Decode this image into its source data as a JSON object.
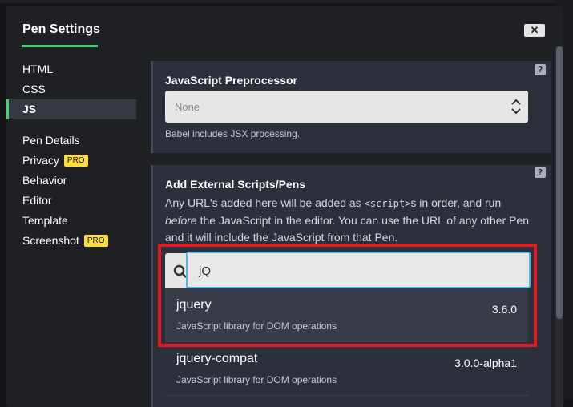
{
  "modal": {
    "title": "Pen Settings",
    "close_label": "✕"
  },
  "sidebar": {
    "items": [
      {
        "label": "HTML"
      },
      {
        "label": "CSS"
      },
      {
        "label": "JS"
      },
      {
        "label": "Pen Details"
      },
      {
        "label": "Privacy",
        "badge": "PRO"
      },
      {
        "label": "Behavior"
      },
      {
        "label": "Editor"
      },
      {
        "label": "Template"
      },
      {
        "label": "Screenshot",
        "badge": "PRO"
      }
    ]
  },
  "preprocessor": {
    "heading": "JavaScript Preprocessor",
    "selected": "None",
    "hint": "Babel includes JSX processing.",
    "help": "?"
  },
  "external": {
    "heading": "Add External Scripts/Pens",
    "help": "?",
    "desc_1": "Any URL's added here will be added as ",
    "desc_code": "<script>",
    "desc_2": "s in order, and run ",
    "desc_em": "before",
    "desc_3": " the JavaScript in the editor. You can use the URL of any other Pen and it will include the JavaScript from that Pen.",
    "search_value": "jQ",
    "results": [
      {
        "name": "jquery",
        "desc": "JavaScript library for DOM operations",
        "version": "3.6.0"
      },
      {
        "name": "jquery-compat",
        "desc": "JavaScript library for DOM operations",
        "version": "3.0.0-alpha1"
      }
    ]
  },
  "colors": {
    "accent": "#47cf73",
    "pro": "#ffdd40",
    "highlight_box": "#e01b22",
    "focus": "#4fb6e3"
  }
}
